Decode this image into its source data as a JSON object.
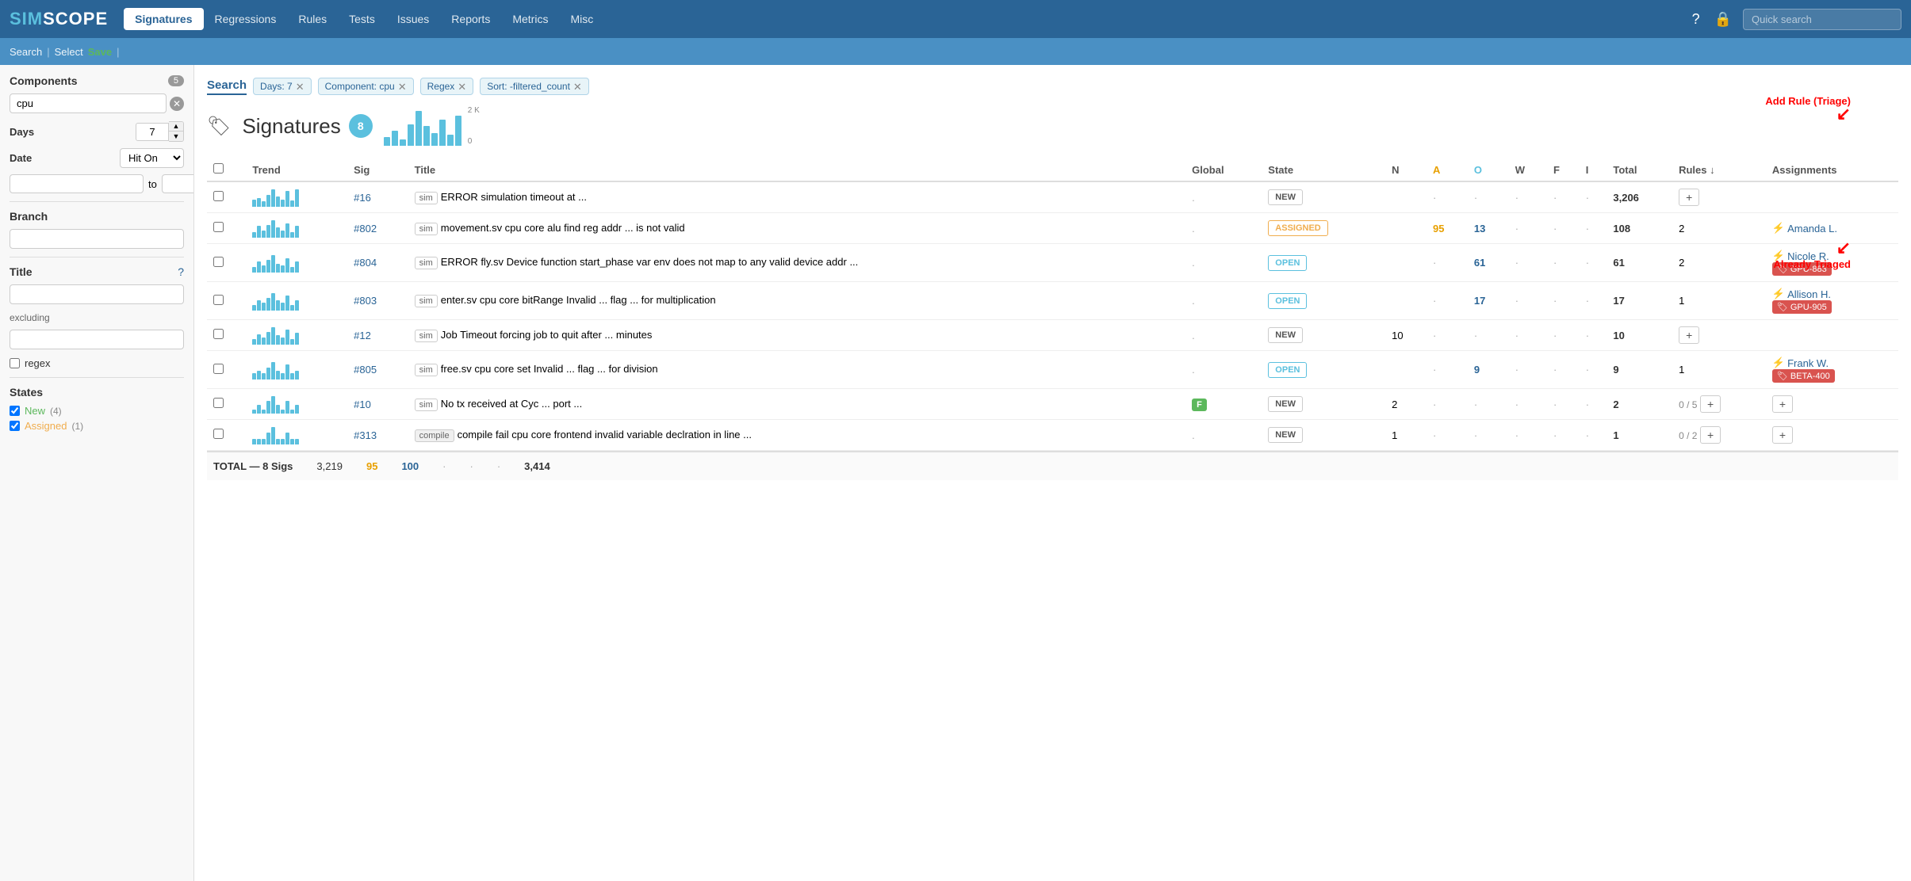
{
  "app": {
    "logo_sim": "SIM",
    "logo_scope": "SCOPE",
    "nav_items": [
      {
        "label": "Signatures",
        "active": true
      },
      {
        "label": "Regressions",
        "active": false
      },
      {
        "label": "Rules",
        "active": false
      },
      {
        "label": "Tests",
        "active": false
      },
      {
        "label": "Issues",
        "active": false
      },
      {
        "label": "Reports",
        "active": false
      },
      {
        "label": "Metrics",
        "active": false
      },
      {
        "label": "Misc",
        "active": false
      }
    ],
    "quick_search_placeholder": "Quick search"
  },
  "sub_nav": {
    "search_label": "Search",
    "select_label": "Select",
    "save_label": "Save"
  },
  "sidebar": {
    "components_label": "Components",
    "components_count": "5",
    "components_value": "cpu",
    "days_label": "Days",
    "days_value": "7",
    "date_label": "Date",
    "date_select": "Hit On",
    "date_from": "",
    "date_to": "to",
    "branch_label": "Branch",
    "branch_value": "",
    "title_label": "Title",
    "title_value": "",
    "excluding_label": "excluding",
    "excluding_value": "",
    "regex_label": "regex",
    "states_label": "States",
    "state_new_label": "New",
    "state_new_count": "(4)",
    "state_new_checked": true,
    "state_assigned_label": "Assigned",
    "state_assigned_count": "(1)"
  },
  "search_tab": {
    "label": "Search",
    "filters": [
      {
        "key": "days",
        "label": "Days: 7"
      },
      {
        "key": "component",
        "label": "Component:  cpu"
      },
      {
        "key": "regex",
        "label": "Regex"
      },
      {
        "key": "sort",
        "label": "Sort: -filtered_count"
      }
    ]
  },
  "signatures": {
    "title": "Signatures",
    "count": "8",
    "chart_bars": [
      20,
      35,
      15,
      50,
      80,
      45,
      30,
      60,
      25,
      70
    ],
    "chart_max": "2 K",
    "chart_min": "0",
    "columns": [
      "",
      "Trend",
      "Sig",
      "Title",
      "Global",
      "State",
      "N",
      "A",
      "O",
      "W",
      "F",
      "I",
      "Total",
      "Rules",
      "Assignments"
    ],
    "rows": [
      {
        "sig": "#16",
        "type": "sim",
        "title": "ERROR simulation timeout at ...",
        "global": ".",
        "state": "NEW",
        "state_type": "new",
        "n": "",
        "a": "·",
        "o": "·",
        "w": "·",
        "f": "·",
        "i": "·",
        "total": "3,206",
        "rules": "+",
        "rules_type": "plus",
        "assignment": "",
        "trend_heights": [
          8,
          10,
          6,
          14,
          20,
          12,
          8,
          18,
          7,
          20
        ]
      },
      {
        "sig": "#802",
        "type": "sim",
        "title": "movement.sv cpu core alu find reg addr ... is not valid",
        "global": ".",
        "state": "ASSIGNED",
        "state_type": "assigned",
        "n": "",
        "a": "95",
        "o": "13",
        "w": "·",
        "f": "·",
        "i": "·",
        "total": "108",
        "rules": "2",
        "rules_type": "number",
        "assignment": "Amanda L.",
        "trend_heights": [
          4,
          8,
          5,
          9,
          12,
          7,
          5,
          10,
          4,
          8
        ]
      },
      {
        "sig": "#804",
        "type": "sim",
        "title": "ERROR fly.sv Device function start_phase var env does not map to any valid device addr ...",
        "global": ".",
        "state": "OPEN",
        "state_type": "open",
        "n": "",
        "a": "·",
        "o": "61",
        "w": "·",
        "f": "·",
        "i": "·",
        "total": "61",
        "rules": "2",
        "rules_type": "number",
        "assignment": "Nicole R.",
        "rule_tag": "GPU-883",
        "trend_heights": [
          3,
          6,
          4,
          7,
          10,
          5,
          4,
          8,
          3,
          6
        ]
      },
      {
        "sig": "#803",
        "type": "sim",
        "title": "enter.sv cpu core bitRange Invalid ... flag ... for multiplication",
        "global": ".",
        "state": "OPEN",
        "state_type": "open",
        "n": "",
        "a": "·",
        "o": "17",
        "w": "·",
        "f": "·",
        "i": "·",
        "total": "17",
        "rules": "1",
        "rules_type": "number",
        "assignment": "Allison H.",
        "rule_tag": "GPU-905",
        "trend_heights": [
          2,
          4,
          3,
          5,
          7,
          4,
          3,
          6,
          2,
          4
        ]
      },
      {
        "sig": "#12",
        "type": "sim",
        "title": "Job Timeout forcing job to quit after ... minutes",
        "global": ".",
        "state": "NEW",
        "state_type": "new",
        "n": "10",
        "a": "·",
        "o": "·",
        "w": "·",
        "f": "·",
        "i": "·",
        "total": "10",
        "rules": "+",
        "rules_type": "plus",
        "assignment": "",
        "trend_heights": [
          5,
          9,
          6,
          11,
          15,
          8,
          6,
          13,
          5,
          10
        ]
      },
      {
        "sig": "#805",
        "type": "sim",
        "title": "free.sv cpu core set Invalid ... flag ... for division",
        "global": ".",
        "state": "OPEN",
        "state_type": "open",
        "n": "",
        "a": "·",
        "o": "9",
        "w": "·",
        "f": "·",
        "i": "·",
        "total": "9",
        "rules": "1",
        "rules_type": "number",
        "assignment": "Frank W.",
        "rule_tag": "BETA-400",
        "trend_heights": [
          2,
          3,
          2,
          4,
          6,
          3,
          2,
          5,
          2,
          3
        ]
      },
      {
        "sig": "#10",
        "type": "sim",
        "title": "No tx received at Cyc ... port ...",
        "global": "F",
        "global_type": "badge",
        "state": "NEW",
        "state_type": "new",
        "n": "2",
        "a": "·",
        "o": "·",
        "w": "·",
        "f": "·",
        "i": "·",
        "total": "2",
        "rules": "0 / 5",
        "rules_type": "progress",
        "assignment": "+",
        "trend_heights": [
          1,
          2,
          1,
          3,
          4,
          2,
          1,
          3,
          1,
          2
        ]
      },
      {
        "sig": "#313",
        "type": "compile",
        "title": "compile fail cpu core frontend invalid variable declration in line ...",
        "global": ".",
        "state": "NEW",
        "state_type": "new",
        "n": "1",
        "a": "·",
        "o": "·",
        "w": "·",
        "f": "·",
        "i": "·",
        "total": "1",
        "rules": "0 / 2",
        "rules_type": "progress",
        "assignment": "+",
        "trend_heights": [
          1,
          1,
          1,
          2,
          3,
          1,
          1,
          2,
          1,
          1
        ]
      }
    ],
    "total_label": "TOTAL — 8 Sigs",
    "total_n": "3,219",
    "total_a": "95",
    "total_o": "100",
    "total_w": "·",
    "total_f": "·",
    "total_i": "·",
    "total_count": "3,414"
  },
  "annotations": {
    "add_rule": "Add Rule (Triage)",
    "already_triaged": "Already Triaged"
  },
  "bottom_bar": {
    "new_label": "New"
  }
}
